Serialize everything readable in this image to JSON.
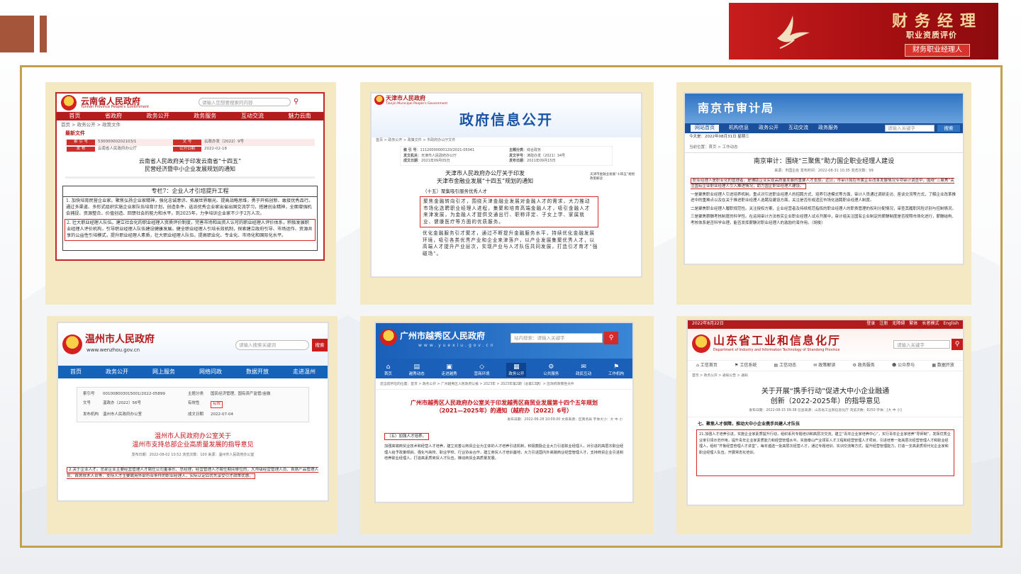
{
  "banner": {
    "title": "财务经理",
    "subtitle": "职业资质评价",
    "tag": "财务职业经理人"
  },
  "cards": {
    "yunnan": {
      "site": "云南省人民政府",
      "site_en": "Yunnan Province People's Government",
      "search_placeholder": "请输入您想要搜索的内容",
      "nav": [
        "首页",
        "省政府",
        "政务公开",
        "政务服务",
        "互动交流",
        "魅力云南"
      ],
      "breadcrumb": "首页 > 政务公开 > 政策文件",
      "section": "最新文件",
      "meta": [
        [
          "索 引 号",
          "53000000202103/1",
          "文  号",
          "云政办发〔2022〕9号"
        ],
        [
          "发 布",
          "云南省人民政府办公厅",
          "公开日期",
          "2022-02-18"
        ]
      ],
      "title1": "云南省人民政府关于印发云南省“十四五”",
      "title2": "民营经济暨中小企业发展规划的通知",
      "box_title": "专栏7：企业人才引培提升工程",
      "p1": "1. 加快培育民营企业家。聚焦弘扬企业家精神，强化忠诚意识、拓展世界眼光、提高战略思维，勇于开拓创新、敢接优秀品行。通过多渠道、多形式组织实施企业家队伍培育计划，创造条件，选派优秀企业家出省出国交流学习，搭建创业精神，全面增强机会捕捉、资源整合、价值创造、回馈社会的能力和水平。到2025年，力争培训企业家不少于2万人次。",
      "p2": "2. 壮大职业经理人队伍。建立社会化的职业经理人资质评价制度，完善市场和出资人认可的职业经理人评价体系，积极发展职业经理人评价机构，引导职业经理人队伍建设健康发展。健全职业经理人引培长效机制，探索建立政府引导、市场运作、资源共享的公益性引培模式，提升职业经理人素质，壮大职业经理人队伍，提高职业化、专业化、市场化和国际化水平。"
    },
    "tianjin": {
      "site": "天津市人民政府",
      "site_en": "Tianjin Municipal People's Government",
      "header": "政府信息公开",
      "breadcrumb": "首页 > 政务公开 > 政策文件 > 市政府办公厅文件",
      "meta": [
        [
          "索 引 号",
          "11120000000120/2021-05041"
        ],
        [
          "主题分类",
          "综合政务"
        ],
        [
          "发文机关",
          "天津市人民政府办公厅"
        ],
        [
          "发文字号",
          "津政办发〔2021〕34号"
        ],
        [
          "成文日期",
          "2021年09月05日"
        ],
        [
          "发布日期",
          "2021年09月15日"
        ]
      ],
      "title1": "天津市人民政府办公厅关于印发",
      "title2": "天津市金融业发展“十四五”规划的通知",
      "side_note": "天津市金融业发展“十四五”规划政策解读",
      "section": "（十五）聚集吸引服务优秀人才",
      "p1": "聚焦金融转向引才，围绕天津金融业发展对金融人才的需求，大力推动市场化选聘职业经理人进程，集聚和培育高端金融人才，吸引金融人才来津发展，为金融人才提供交通出行、职称评定、子女上学、家属就业、健康医疗等方面的优质服务。",
      "p2": "优化金融服务引才聚才，通过不断提升金融服务水平，持续优化金融发展环境，吸引各类优秀产业和企业来津落户，以产业发展集聚优秀人才，以高端人才提升产业层次，实现产业与人才队伍共同发展，打造引才育才“强磁场”。"
    },
    "nanjing": {
      "site": "南京市审计局",
      "nav": [
        "网站首页",
        "机构信息",
        "政务公开",
        "互动交流",
        "政务服务"
      ],
      "search_placeholder": "请输入关键字",
      "search_btn": "搜索",
      "today": "今天是：2022年08月31日 星期三",
      "breadcrumb": "当前位置：首页 > 工作动态",
      "title": "南京审计：围绕“三聚焦”助力国企职业经理人建设",
      "meta": "来源：市国企处  发布时间：2022-08-31 10:35  浏览次数：99",
      "p1": "职业经理人是职业化的管理者，是辅助企业实现高质量发展的重要人才支撑。近日，市审计局在市属企业改革发展情况专项审计调查中，围绕“三聚焦”关注国有企业职业经理人引入推进情况，助力国企职业经理人建设。",
      "p2": "一是聚焦职业经理人引进培养机制。重点对引进职业经理人的招聘方式、培养引进模式等方面，审计人员通过调研走访、座谈交流等方式，了解企业改革推进中的重难点以及在关于推进职业经理人选聘及建设方面，关注是否形成适应市场化选聘职业经理人制度。",
      "p3": "二是聚焦职业经理人履职规范性。关注授权方案，企业经营者及持续规范指挥的职业经理人的职责管理的权利分配情况，审查其履职风险识别与控制情况。",
      "p4": "三是聚焦薪酬考核制度的科学性。在运用审计方法核实企业职业经理人试点开展中，审计组关注国有企业制定的薪酬制度是否按照市场化进行，薪酬结构、考核体系是否科学合理，能否发挥薪酬对职业经理人的激励约束作用。（胡俊）"
    },
    "wenzhou": {
      "site": "温州市人民政府",
      "site_url": "www.wenzhou.gov.cn",
      "search_placeholder": "请输入搜索关键词",
      "search_btn": "搜索",
      "nav": [
        "首页",
        "政务公开",
        "网上服务",
        "网络问政",
        "数据开放",
        "走进温州"
      ],
      "meta": [
        [
          "索引号",
          "001008003015001/2022-05899",
          "主题分类",
          "国民经济管理、国有资产监管/金融"
        ],
        [
          "文号",
          "温政办〔2022〕56号",
          "有效性",
          "有效"
        ],
        [
          "发布机构",
          "温州市人民政府办公室",
          "成文日期",
          "2022-07-04"
        ]
      ],
      "title1": "温州市人民政府办公室关于",
      "title2": "温州市支持总部企业高质量发展的指导意见",
      "info": "发布日期：2022-08-02 10:52  浏览次数：100  来源：温州市人民政府办公室",
      "p1": "2.关于企业人才。总部企业主要经营管理人才聘任公司董事长、总经理，经营管理人才聘任期间单位的，大师级经营管理人员、首席产品管理人员、首席技术人员等，支持人才主要聘用外部符合条件的职业经理人，实际认定后优先享受引才政策优惠。"
    },
    "guangzhou": {
      "site": "广州市越秀区人民政府",
      "site_url": "www.yuexiu.gov.cn",
      "search_placeholder": "站内搜索：请输入关键字",
      "nav": [
        "首页",
        "越秀动态",
        "走进越秀",
        "营商环境",
        "政务公开",
        "公共服务",
        "政民互动",
        "工作机构"
      ],
      "breadcrumb": "您当前所在的位置：首页 > 政务公开 > 广州越秀区人民政府公报 > 2023年 > 2023年第2期（总第13期）> 区政府政策性文件",
      "title1": "广州市越秀区人民政府办公室关于印发越秀区商贸业发展第十四个五年规划",
      "title2": "（2021—2025年）的通知（越府办〔2022〕6号）",
      "info": "发布日期：2022-06-28 10:09:00  文章来源：区商务局  字体大小：大 中 小",
      "section": "（五）加强人才培养。",
      "p1": "加强高端商贸业技术和经营人才培养，建立完善以商贸企业为主体的人才培养引进机制，积极鼓励企业大力引进职业经理人，对引进的高层次职业经理人给予政策倾斜。强化与高校、职业学校、行业协会合作，建立商贸人才培训基地，大力引进国内外高端商业经营管理人才，支持商贸企业引进和培养职业经理人，打造高素质商贸人才队伍，推动商贸业高质量发展。"
    },
    "shandong": {
      "date": "2022年8月22日",
      "top_links": [
        "登录",
        "注册",
        "无障碍",
        "繁体",
        "长者模式",
        "English"
      ],
      "site": "山东省工业和信息化厅",
      "site_en": "Department of Industry and Information Technology of Shandong Province",
      "search_placeholder": "请输入关键字",
      "nav": [
        "工信首页",
        "工信系统",
        "工信动态",
        "政策解读",
        "政务服务",
        "公众参与",
        "数据开放"
      ],
      "breadcrumb": "首页 > 政务公开 > 通知公告 > 通知",
      "title1": "关于开展“携手行动”促进大中小企业融通",
      "title2": "创新（2022-2025年）的指导意见",
      "info": "发布日期：2022-08-15 09:38  信息来源：山东省工业和信息化厅  浏览次数：8250  字体：[大 中 小]",
      "section": "七、聚焦人才保障，推动大中小企业携手共建人才队伍",
      "p1": "21.加强人才培养引进。实施企业家素质提升行动，组织系列专题培训和高层次交流，建立“青年企业家培养中心”，实行青年企业家培养“导师制”，发挥优秀企业家引领示范作用，提升青年企业家素质能力和经营管理水平。实施泰山产业领军人才工程和经营管理人才项目。引进培育一批高层次经营管理人才和职业经理人，组织“齐鲁经营管理人才讲堂”，每年遴选一批高层次经营人才，通过专题培训、实训交流等方式，提升经营管理能力，打造一支高素质现代化企业家和职业经理人队伍，开展常态化培训。"
    }
  }
}
